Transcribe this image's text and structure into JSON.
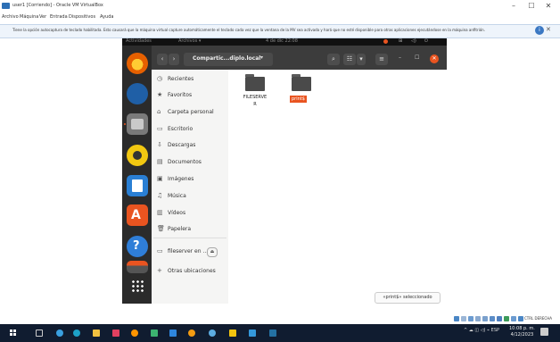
{
  "window": {
    "title": "user1 [Corriendo] - Oracle VM VirtualBox",
    "controls": {
      "minimize": "–",
      "maximize": "☐",
      "close": "✕"
    }
  },
  "vb_menu": [
    "Archivo",
    "Máquina",
    "Ver",
    "Entrada",
    "Dispositivos",
    "Ayuda"
  ],
  "infobar": {
    "text": "Tiene la opción autocaptura de teclado habilitada. Esto causará que la máquina virtual capture automáticamente el teclado cada vez que la ventana de la MV sea activada y hará que no esté disponible para otras aplicaciones ejecutándose en la máquina anfitrión.",
    "close": "✕"
  },
  "gnome": {
    "activities": "Actividades",
    "app_menu": "Archivos ▾",
    "clock": "4 de dic 22:08"
  },
  "headerbar": {
    "back": "‹",
    "forward": "›",
    "path": "Compartic...diplo.local",
    "path_caret": "▾",
    "search": "⌕",
    "view_list": "☷",
    "view_caret": "▾",
    "menu": "≡",
    "minimize": "–",
    "maximize": "☐",
    "close": "✕"
  },
  "sidebar": [
    {
      "icon": "◷",
      "label": "Recientes"
    },
    {
      "icon": "★",
      "label": "Favoritos"
    },
    {
      "icon": "⌂",
      "label": "Carpeta personal"
    },
    {
      "icon": "▭",
      "label": "Escritorio"
    },
    {
      "icon": "⇩",
      "label": "Descargas"
    },
    {
      "icon": "▤",
      "label": "Documentos"
    },
    {
      "icon": "▣",
      "label": "Imágenes"
    },
    {
      "icon": "♫",
      "label": "Música"
    },
    {
      "icon": "▥",
      "label": "Vídeos"
    },
    {
      "icon": "🗑",
      "label": "Papelera"
    },
    {
      "icon": "▭",
      "label": "fileserver en ..."
    },
    {
      "icon": "+",
      "label": "Otras ubicaciones"
    }
  ],
  "eject_label": "⏏",
  "files": [
    {
      "label_line1": "FILESERVE",
      "label_line2": "R",
      "selected": false
    },
    {
      "label_line1": "print$",
      "label_line2": "",
      "selected": true
    }
  ],
  "status_text": "«print$» seleccionado",
  "statusbar": {
    "host_key": "CTRL DERECHA"
  },
  "taskbar": {
    "tray_text": "^ ☁ ◫ ◁) ⌁ ESP",
    "time": "10:08 p. m.",
    "date": "4/12/2023"
  },
  "dock_apps": [
    {
      "name": "firefox",
      "color": "#e66000"
    },
    {
      "name": "thunderbird",
      "color": "#1f5fa6"
    },
    {
      "name": "files",
      "color": "#7a7a7a"
    },
    {
      "name": "rhythmbox",
      "color": "#f2c811"
    },
    {
      "name": "writer",
      "color": "#2a7fd4"
    },
    {
      "name": "software",
      "color": "#e95420"
    },
    {
      "name": "help",
      "color": "#2f7ed8"
    },
    {
      "name": "drive",
      "color": "#555555"
    },
    {
      "name": "show-apps",
      "color": "#2b2b2b"
    }
  ],
  "accent_color": "#e95420"
}
